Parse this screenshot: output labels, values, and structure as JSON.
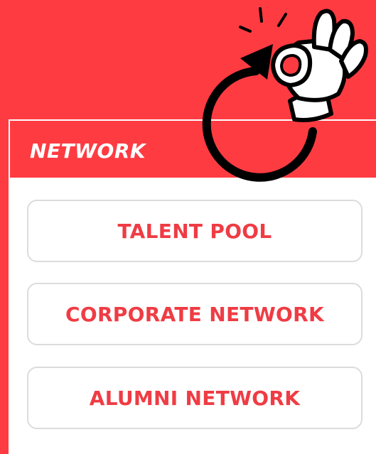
{
  "panel": {
    "title": "NETWORK"
  },
  "nav": {
    "items": [
      {
        "label": "TALENT POOL"
      },
      {
        "label": "CORPORATE NETWORK"
      },
      {
        "label": "ALUMNI NETWORK"
      }
    ]
  },
  "graphic": {
    "icon": "ok-hand-icon",
    "arrow_icon": "circular-arrow-icon"
  },
  "colors": {
    "brand": "#ff3b42",
    "button_text": "#ef3c44",
    "button_border": "#dcdcdc",
    "panel_bg": "#ffffff"
  }
}
